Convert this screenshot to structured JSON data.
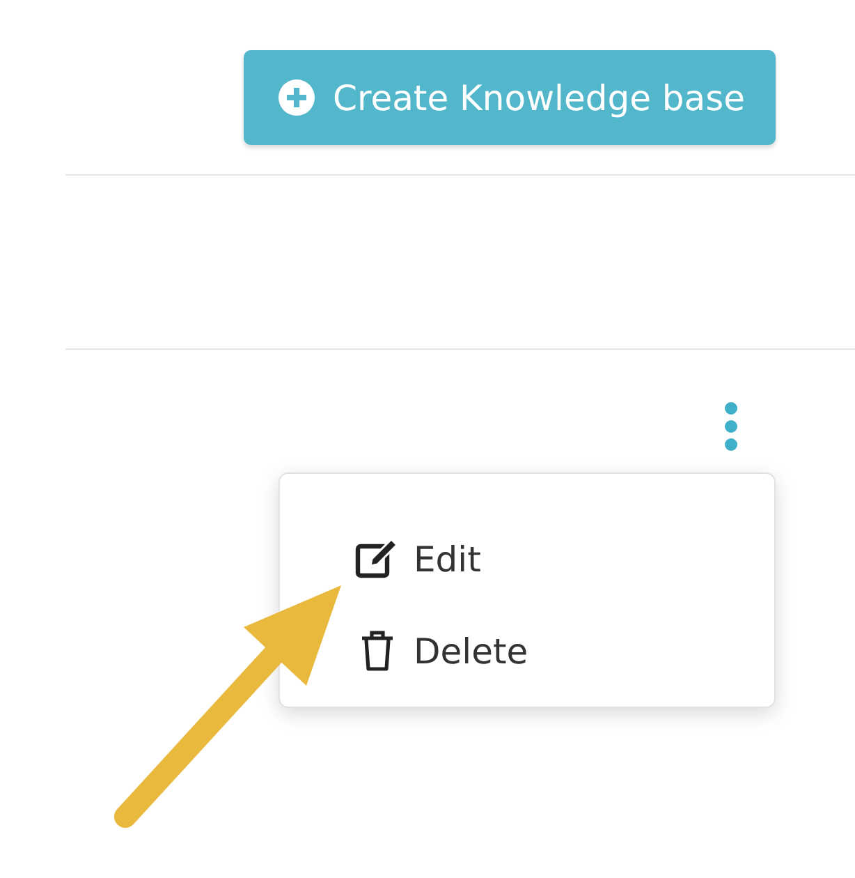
{
  "create_button": {
    "label": "Create Knowledge base"
  },
  "row_menu": {
    "expanded": true,
    "items": [
      {
        "kind": "edit",
        "label": "Edit"
      },
      {
        "kind": "delete",
        "label": "Delete"
      }
    ]
  }
}
